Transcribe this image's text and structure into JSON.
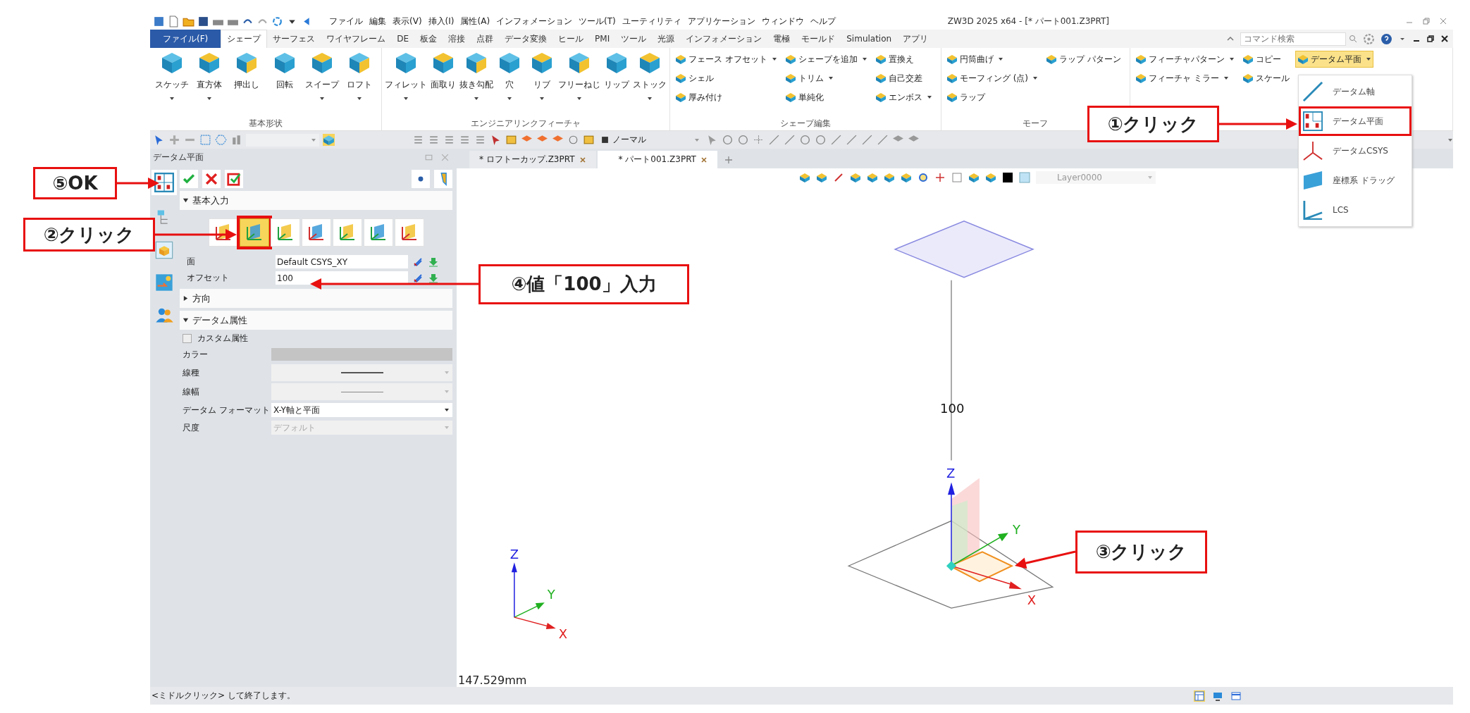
{
  "window": {
    "title": "ZW3D 2025 x64 - [* パート001.Z3PRT]"
  },
  "menu": [
    "ファイル",
    "編集",
    "表示(V)",
    "挿入(I)",
    "属性(A)",
    "インフォメーション",
    "ツール(T)",
    "ユーティリティ",
    "アプリケーション",
    "ウィンドウ",
    "ヘルプ"
  ],
  "ribbon_tabs": [
    {
      "label": "ファイル(F)",
      "kind": "file",
      "selected": false
    },
    {
      "label": "シェープ",
      "kind": "tab",
      "selected": true
    },
    {
      "label": "サーフェス",
      "kind": "tab",
      "selected": false
    },
    {
      "label": "ワイヤフレーム",
      "kind": "tab",
      "selected": false
    },
    {
      "label": "DE",
      "kind": "tab",
      "selected": false
    },
    {
      "label": "板金",
      "kind": "tab",
      "selected": false
    },
    {
      "label": "溶接",
      "kind": "tab",
      "selected": false
    },
    {
      "label": "点群",
      "kind": "tab",
      "selected": false
    },
    {
      "label": "データ変換",
      "kind": "tab",
      "selected": false
    },
    {
      "label": "ヒール",
      "kind": "tab",
      "selected": false
    },
    {
      "label": "PMI",
      "kind": "tab",
      "selected": false
    },
    {
      "label": "ツール",
      "kind": "tab",
      "selected": false
    },
    {
      "label": "光源",
      "kind": "tab",
      "selected": false
    },
    {
      "label": "インフォメーション",
      "kind": "tab",
      "selected": false
    },
    {
      "label": "電極",
      "kind": "tab",
      "selected": false
    },
    {
      "label": "モールド",
      "kind": "tab",
      "selected": false
    },
    {
      "label": "Simulation",
      "kind": "tab",
      "selected": false
    },
    {
      "label": "アプリ",
      "kind": "tab",
      "selected": false
    }
  ],
  "command_search": {
    "placeholder": "コマンド検索"
  },
  "ribbon_groups": [
    {
      "title": "基本形状",
      "kind": "large",
      "buttons": [
        {
          "label": "スケッチ",
          "dropdown": true
        },
        {
          "label": "直方体",
          "dropdown": true
        },
        {
          "label": "押出し",
          "dropdown": false
        },
        {
          "label": "回転",
          "dropdown": false
        },
        {
          "label": "スイープ",
          "dropdown": true
        },
        {
          "label": "ロフト",
          "dropdown": true
        }
      ]
    },
    {
      "title": "エンジニアリンクフィーチャ",
      "kind": "large",
      "buttons": [
        {
          "label": "フィレット",
          "dropdown": true
        },
        {
          "label": "面取り",
          "dropdown": false
        },
        {
          "label": "抜き勾配",
          "dropdown": true
        },
        {
          "label": "穴",
          "dropdown": true
        },
        {
          "label": "リブ",
          "dropdown": true
        },
        {
          "label": "フリーねじ",
          "dropdown": true
        },
        {
          "label": "リップ",
          "dropdown": false
        },
        {
          "label": "ストック",
          "dropdown": true
        }
      ]
    },
    {
      "title": "シェープ編集",
      "kind": "small",
      "columns": [
        [
          {
            "label": "フェース オフセット",
            "dropdown": true,
            "highlighted": false
          },
          {
            "label": "シェル",
            "dropdown": false,
            "highlighted": false
          },
          {
            "label": "厚み付け",
            "dropdown": false,
            "highlighted": false
          }
        ],
        [
          {
            "label": "シェープを追加",
            "dropdown": true,
            "highlighted": false
          },
          {
            "label": "トリム",
            "dropdown": true,
            "highlighted": false
          },
          {
            "label": "単純化",
            "dropdown": false,
            "highlighted": false
          }
        ],
        [
          {
            "label": "置換え",
            "dropdown": false,
            "highlighted": false
          },
          {
            "label": "自己交差",
            "dropdown": false,
            "highlighted": false
          },
          {
            "label": "エンボス",
            "dropdown": true,
            "highlighted": false
          }
        ]
      ]
    },
    {
      "title": "モーフ",
      "kind": "small",
      "columns": [
        [
          {
            "label": "円筒曲げ",
            "dropdown": true,
            "highlighted": false
          },
          {
            "label": "モーフィング (点)",
            "dropdown": true,
            "highlighted": false
          },
          {
            "label": "ラップ",
            "dropdown": false,
            "highlighted": false
          }
        ],
        [
          {
            "label": "ラップ パターン",
            "dropdown": false,
            "highlighted": false
          }
        ]
      ]
    },
    {
      "kind": "small",
      "columns": [
        [
          {
            "label": "フィーチャパターン",
            "dropdown": true,
            "highlighted": false
          },
          {
            "label": "フィーチャ ミラー",
            "dropdown": true,
            "highlighted": false
          }
        ],
        [
          {
            "label": "コピー",
            "dropdown": false,
            "highlighted": false
          },
          {
            "label": "スケール",
            "dropdown": false,
            "highlighted": false
          }
        ],
        [
          {
            "label": "データム平面",
            "dropdown": true,
            "highlighted": true
          }
        ]
      ]
    }
  ],
  "dropdown_menu": [
    {
      "label": "データム軸",
      "annotated": false
    },
    {
      "label": "データム平面",
      "annotated": true
    },
    {
      "label": "データムCSYS",
      "annotated": false
    },
    {
      "label": "座標系 ドラッグ",
      "annotated": false
    },
    {
      "label": "LCS",
      "annotated": false
    }
  ],
  "toolbar": {
    "display_mode": "ノーマル"
  },
  "doc_tabs": [
    {
      "label": "* ロフトーカップ.Z3PRT",
      "selected": false
    },
    {
      "label": "* パート001.Z3PRT",
      "selected": true
    }
  ],
  "layer": "Layer0000",
  "panel": {
    "title": "データム平面",
    "basic_input": {
      "title": "基本入力",
      "expanded": true,
      "methods": [
        {
          "selected": false,
          "annotated": false
        },
        {
          "selected": true,
          "annotated": true
        },
        {
          "selected": false,
          "annotated": false
        },
        {
          "selected": false,
          "annotated": false
        },
        {
          "selected": false,
          "annotated": false
        },
        {
          "selected": false,
          "annotated": false
        },
        {
          "selected": false,
          "annotated": false
        }
      ],
      "fields": [
        {
          "label": "面",
          "value": "Default CSYS_XY"
        },
        {
          "label": "オフセット",
          "value": "100"
        }
      ]
    },
    "direction": {
      "title": "方向",
      "expanded": false
    },
    "attributes": {
      "title": "データム属性",
      "expanded": true,
      "custom": {
        "label": "カスタム属性",
        "checked": false
      },
      "rows": [
        {
          "label": "カラー",
          "kind": "color"
        },
        {
          "label": "線種",
          "kind": "line"
        },
        {
          "label": "線幅",
          "kind": "line"
        },
        {
          "label": "データム フォーマット",
          "kind": "select",
          "value": "X-Y軸と平面",
          "disabled": false
        },
        {
          "label": "尺度",
          "kind": "select",
          "value": "デフォルト",
          "disabled": true
        }
      ]
    }
  },
  "viewport": {
    "dimension": "100",
    "axis_labels": [
      "Z",
      "Y",
      "X"
    ],
    "triad_labels": [
      "Z",
      "Y",
      "X"
    ],
    "measurement": "147.529mm"
  },
  "status_bar": {
    "message": "<ミドルクリック> して終了します。"
  },
  "callouts": [
    {
      "text": "①クリック"
    },
    {
      "text": "②クリック"
    },
    {
      "text": "③クリック"
    },
    {
      "text": "④値「100」入力"
    },
    {
      "text": "⑤OK"
    }
  ]
}
